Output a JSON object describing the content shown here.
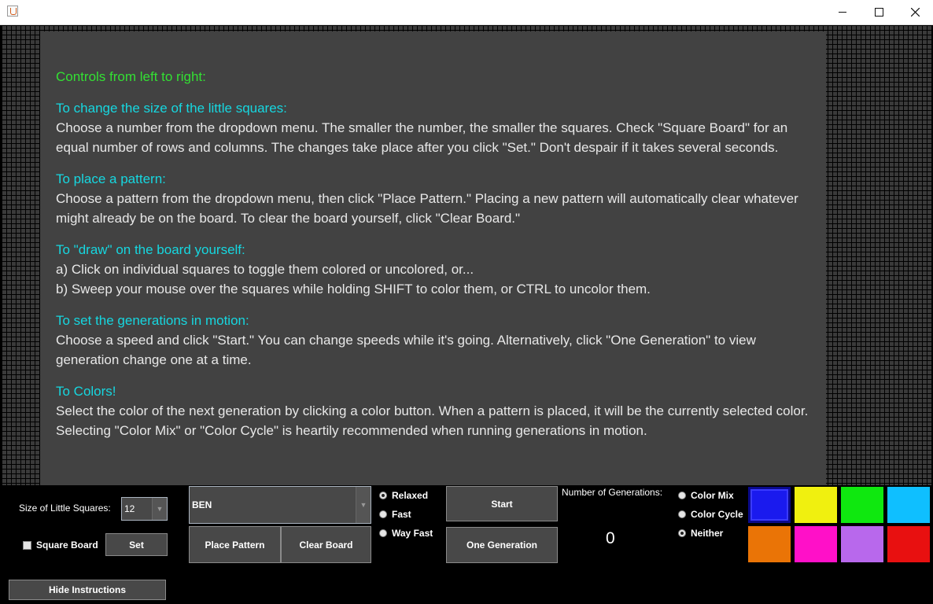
{
  "instructions": {
    "intro": "Controls from left to right:",
    "sections": [
      {
        "heading": "To change the size of the little squares:",
        "lines": [
          "Choose a number from the dropdown menu.   The smaller the number, the smaller the squares.    Check \"Square Board\" for an equal number of rows and columns.   The changes take place after you click \"Set.\"   Don't despair if it takes several seconds."
        ]
      },
      {
        "heading": "To place a pattern:",
        "lines": [
          "Choose a pattern from the dropdown menu, then click \"Place Pattern.\"    Placing a new pattern will automatically clear whatever might already be on the board.    To clear the board yourself, click \"Clear Board.\""
        ]
      },
      {
        "heading": "To \"draw\" on the board yourself:",
        "lines": [
          "a)   Click on individual squares to toggle them colored or uncolored, or...",
          "b)   Sweep your mouse over the squares while holding SHIFT to color them, or CTRL to uncolor them."
        ]
      },
      {
        "heading": "To set the generations in motion:",
        "lines": [
          "Choose a speed and click \"Start.\"    You can change speeds while it's going.   Alternatively, click \"One Generation\" to view generation change one at a time."
        ]
      },
      {
        "heading": "To Colors!",
        "lines": [
          "Select the color of the next generation by clicking a color button.   When a pattern is placed, it will be the currently selected color.  Selecting \"Color Mix\" or \"Color Cycle\" is heartily recommended when running generations in motion."
        ]
      }
    ]
  },
  "controls": {
    "size_label": "Size of Little Squares:",
    "size_value": "12",
    "square_board_label": "Square Board",
    "set_label": "Set",
    "pattern_value": "BEN",
    "place_pattern_label": "Place Pattern",
    "clear_board_label": "Clear Board",
    "speeds": [
      {
        "label": "Relaxed",
        "selected": true
      },
      {
        "label": "Fast",
        "selected": false
      },
      {
        "label": "Way Fast",
        "selected": false
      }
    ],
    "start_label": "Start",
    "one_generation_label": "One Generation",
    "generations_label": "Number of Generations:",
    "generations_value": "0",
    "color_modes": [
      {
        "label": "Color Mix",
        "selected": false
      },
      {
        "label": "Color Cycle",
        "selected": false
      },
      {
        "label": "Neither",
        "selected": true
      }
    ],
    "hide_instructions_label": "Hide Instructions"
  },
  "colors": [
    "#1a1aee",
    "#f0f00f",
    "#0fe80f",
    "#0fbfff",
    "#ea7406",
    "#ff10c8",
    "#b868ec",
    "#e81010"
  ],
  "selected_color_index": 0
}
